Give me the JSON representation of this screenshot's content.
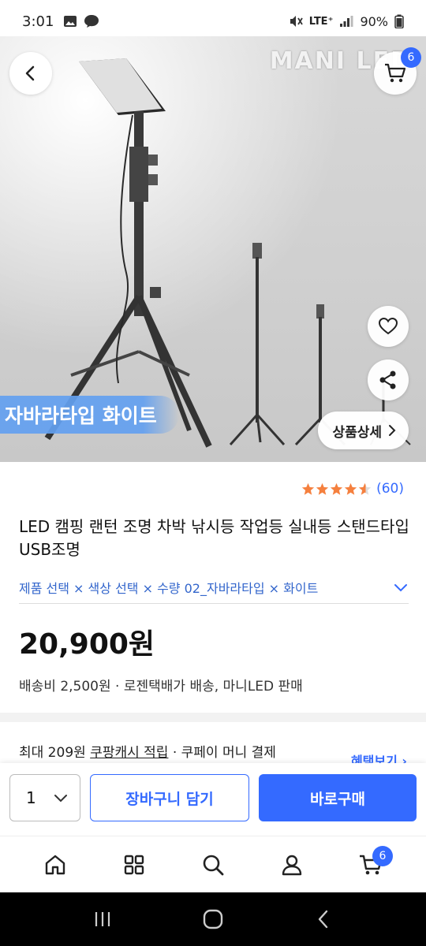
{
  "status": {
    "time": "3:01",
    "battery": "90%",
    "network": "LTE⁺"
  },
  "hero": {
    "brand": "MANI LED",
    "type_label": "자바라타입 화이트",
    "detail_button": "상품상세",
    "cart_count": "6"
  },
  "product": {
    "rating_count": "(60)",
    "rating": 4.5,
    "title": "LED 캠핑 랜턴 조명 차박 낚시등 작업등 실내등 스탠드타입 USB조명",
    "options_text": "제품 선택 × 색상 선택 × 수량  02_자바라타입 × 화이트",
    "price": "20,900원",
    "shipping": "배송비 2,500원 · 로젠택배가 배송, 마니LED 판매",
    "cash_prefix": "최대 209원 ",
    "cash_link": "쿠팡캐시 적립",
    "cash_suffix": " · 쿠페이 머니 결제",
    "benefit_link": "혜택보기 ›"
  },
  "buybar": {
    "quantity": "1",
    "add_to_cart": "장바구니 담기",
    "buy_now": "바로구매"
  },
  "tabbar": {
    "cart_count": "6"
  },
  "colors": {
    "accent": "#346aff",
    "star": "#f5803e"
  }
}
